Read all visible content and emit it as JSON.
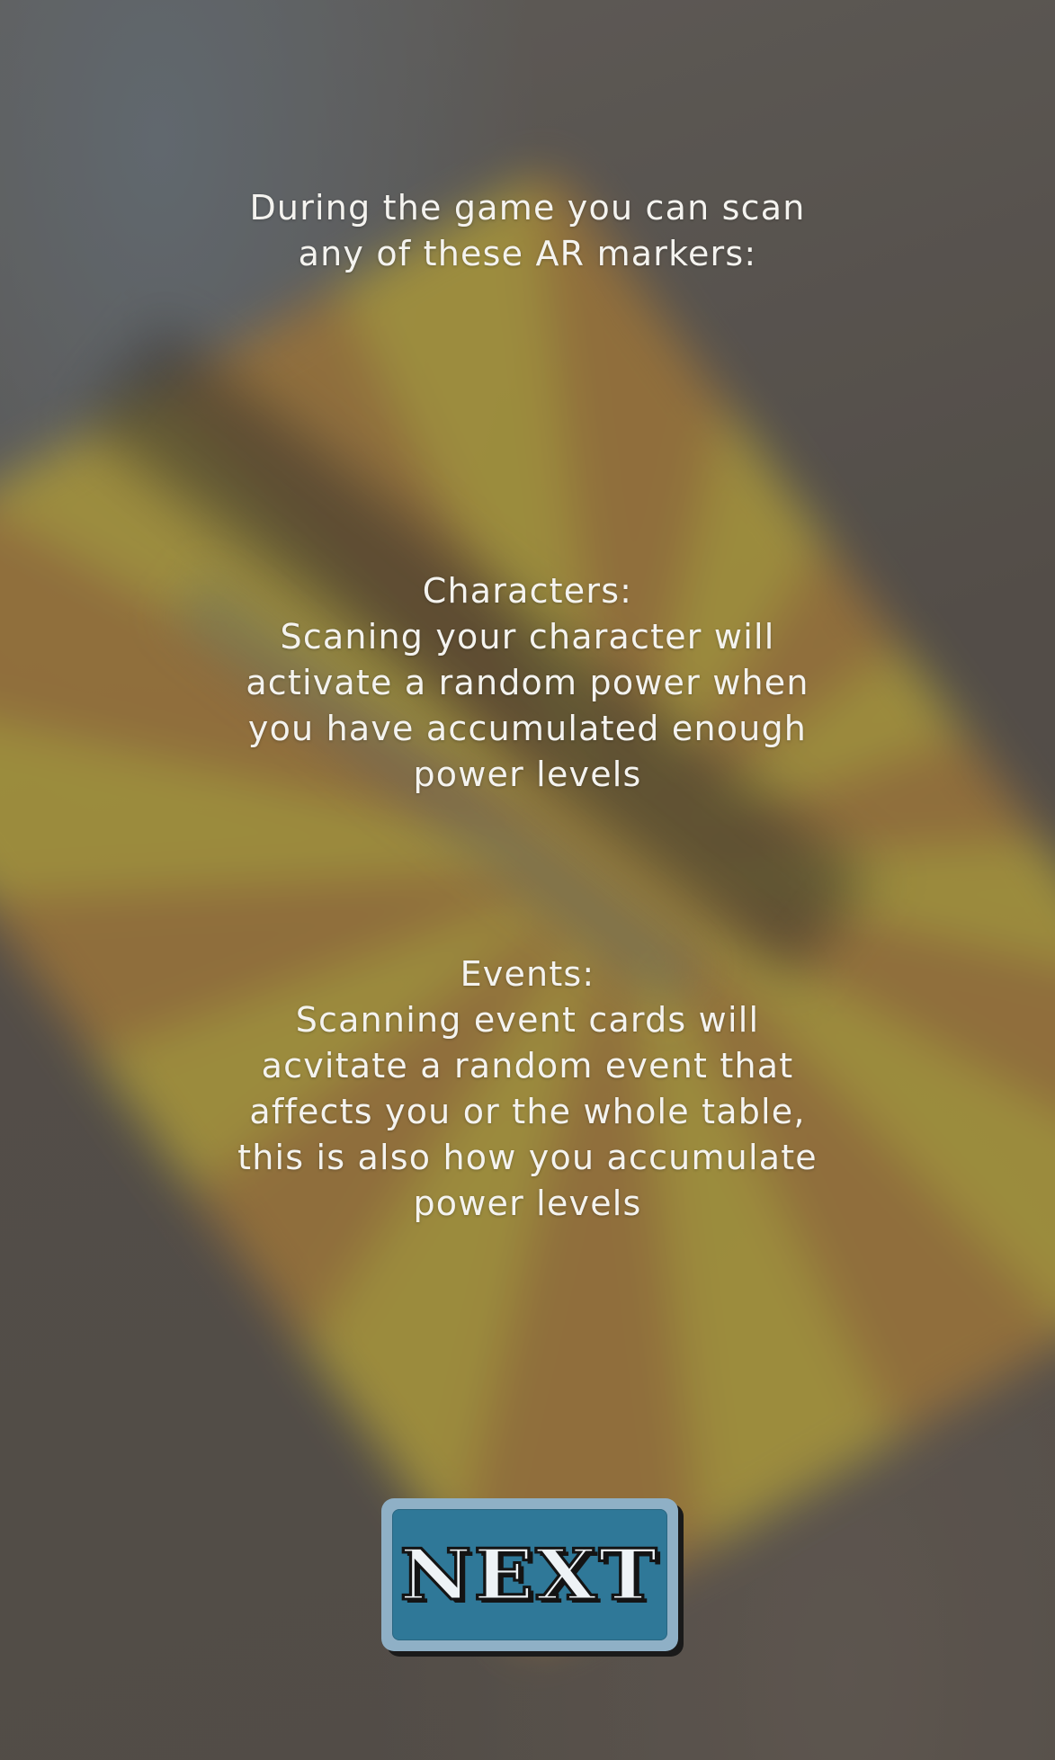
{
  "intro": {
    "lines": [
      "During the game you can scan",
      "any of these AR markers:"
    ]
  },
  "characters": {
    "lines": [
      "Characters:",
      "Scaning your character will",
      "activate a random power when",
      "you have accumulated enough",
      "power levels"
    ]
  },
  "events": {
    "lines": [
      "Events:",
      "Scanning event cards will",
      "acvitate a random event that",
      "affects you or the whole table,",
      "this is also how you accumulate",
      "power levels"
    ]
  },
  "next_button": {
    "label": "NEXT"
  },
  "colors": {
    "button_fill": "#2f7898",
    "button_border": "#8fb0c6",
    "text": "#f4f3ef"
  }
}
